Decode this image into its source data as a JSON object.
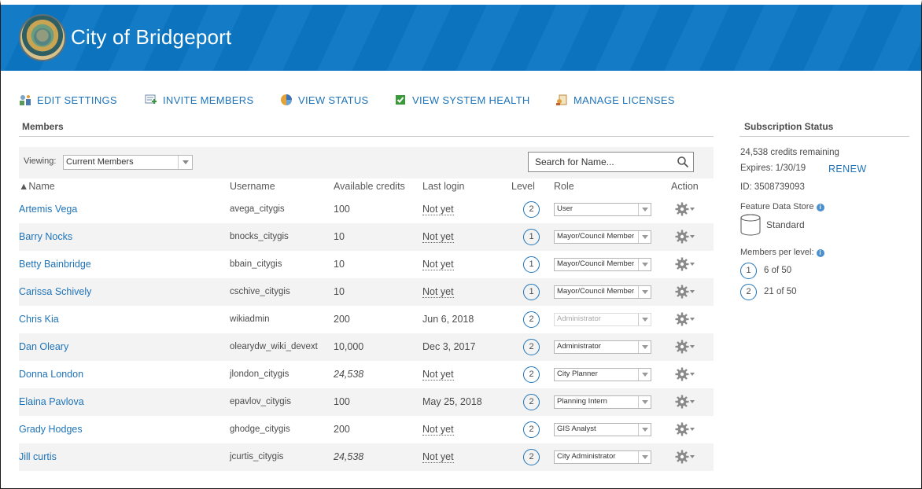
{
  "header": {
    "title": "City of Bridgeport"
  },
  "toolbar": {
    "edit_settings": "EDIT SETTINGS",
    "invite_members": "INVITE MEMBERS",
    "view_status": "VIEW STATUS",
    "view_system_health": "VIEW SYSTEM HEALTH",
    "manage_licenses": "MANAGE LICENSES"
  },
  "members": {
    "title": "Members",
    "viewing_label": "Viewing:",
    "viewing_value": "Current Members",
    "search_placeholder": "Search for Name...",
    "columns": {
      "name": "▲Name",
      "username": "Username",
      "credits": "Available credits",
      "last_login": "Last login",
      "level": "Level",
      "role": "Role",
      "action": "Action"
    },
    "rows": [
      {
        "name": "Artemis Vega",
        "username": "avega_citygis",
        "credits": "100",
        "last_login": "Not yet",
        "level": "2",
        "role": "User"
      },
      {
        "name": "Barry Nocks",
        "username": "bnocks_citygis",
        "credits": "10",
        "last_login": "Not yet",
        "level": "1",
        "role": "Mayor/Council Member"
      },
      {
        "name": "Betty Bainbridge",
        "username": "bbain_citygis",
        "credits": "10",
        "last_login": "Not yet",
        "level": "1",
        "role": "Mayor/Council Member"
      },
      {
        "name": "Carissa Schively",
        "username": "cschive_citygis",
        "credits": "10",
        "last_login": "Not yet",
        "level": "1",
        "role": "Mayor/Council Member"
      },
      {
        "name": "Chris Kia",
        "username": "wikiadmin",
        "credits": "200",
        "last_login": "Jun 6, 2018",
        "level": "2",
        "role": "Administrator"
      },
      {
        "name": "Dan Oleary",
        "username": "olearydw_wiki_devext",
        "credits": "10,000",
        "last_login": "Dec 3, 2017",
        "level": "2",
        "role": "Administrator"
      },
      {
        "name": "Donna London",
        "username": "jlondon_citygis",
        "credits": "24,538",
        "last_login": "Not yet",
        "level": "2",
        "role": "City Planner"
      },
      {
        "name": "Elaina Pavlova",
        "username": "epavlov_citygis",
        "credits": "100",
        "last_login": "May 25, 2018",
        "level": "2",
        "role": "Planning Intern"
      },
      {
        "name": "Grady Hodges",
        "username": "ghodge_citygis",
        "credits": "200",
        "last_login": "Not yet",
        "level": "2",
        "role": "GIS Analyst"
      },
      {
        "name": "Jill curtis",
        "username": "jcurtis_citygis",
        "credits": "24,538",
        "last_login": "Not yet",
        "level": "2",
        "role": "City Administrator"
      }
    ]
  },
  "subscription": {
    "title": "Subscription Status",
    "credits_remaining": "24,538 credits remaining",
    "expires": "Expires: 1/30/19",
    "renew": "RENEW",
    "id": "ID: 3508739093",
    "feature_data_store_label": "Feature Data Store",
    "feature_data_store_value": "Standard",
    "members_per_level_label": "Members per level:",
    "levels": [
      {
        "level": "1",
        "value": "6 of 50"
      },
      {
        "level": "2",
        "value": "21 of 50"
      }
    ]
  },
  "colors": {
    "banner": "#0c78c4",
    "link": "#1e73b8",
    "stripe": "#f3f3f3"
  }
}
